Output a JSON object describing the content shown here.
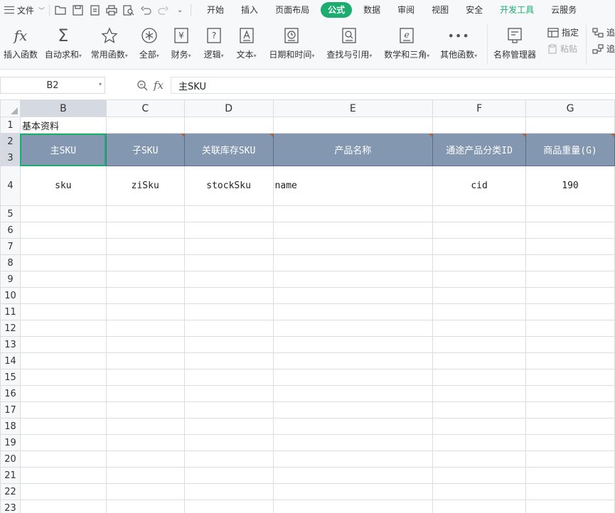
{
  "menubar": {
    "file_label": "文件",
    "tabs": [
      "开始",
      "插入",
      "页面布局",
      "公式",
      "数据",
      "审阅",
      "视图",
      "安全",
      "开发工具",
      "云服务"
    ],
    "active_tab": "公式"
  },
  "ribbon": {
    "insert_function": "插入函数",
    "autosum": "自动求和",
    "common_functions": "常用函数",
    "all": "全部",
    "finance": "财务",
    "logic": "逻辑",
    "text": "文本",
    "datetime": "日期和时间",
    "lookup": "查找与引用",
    "math": "数学和三角",
    "other": "其他函数",
    "name_manager": "名称管理器",
    "assign": "指定",
    "paste": "粘贴",
    "trace1": "追",
    "trace2": "追"
  },
  "formula_bar": {
    "name_box": "B2",
    "fx_label": "fx",
    "content": "主SKU"
  },
  "columns": [
    "B",
    "C",
    "D",
    "E",
    "F",
    "G"
  ],
  "rows": [
    "1",
    "2",
    "3",
    "4",
    "5",
    "6",
    "7",
    "8",
    "9",
    "10",
    "11",
    "12",
    "13",
    "14",
    "15",
    "16",
    "17",
    "18",
    "19",
    "20",
    "21",
    "22",
    "23"
  ],
  "cells": {
    "b1": "基本资料",
    "headers": [
      "主SKU",
      "子SKU",
      "关联库存SKU",
      "产品名称",
      "通途产品分类ID",
      "商品重量(G)"
    ],
    "row4": [
      "sku",
      "ziSku",
      "stockSku",
      "name",
      "cid",
      "190"
    ]
  }
}
